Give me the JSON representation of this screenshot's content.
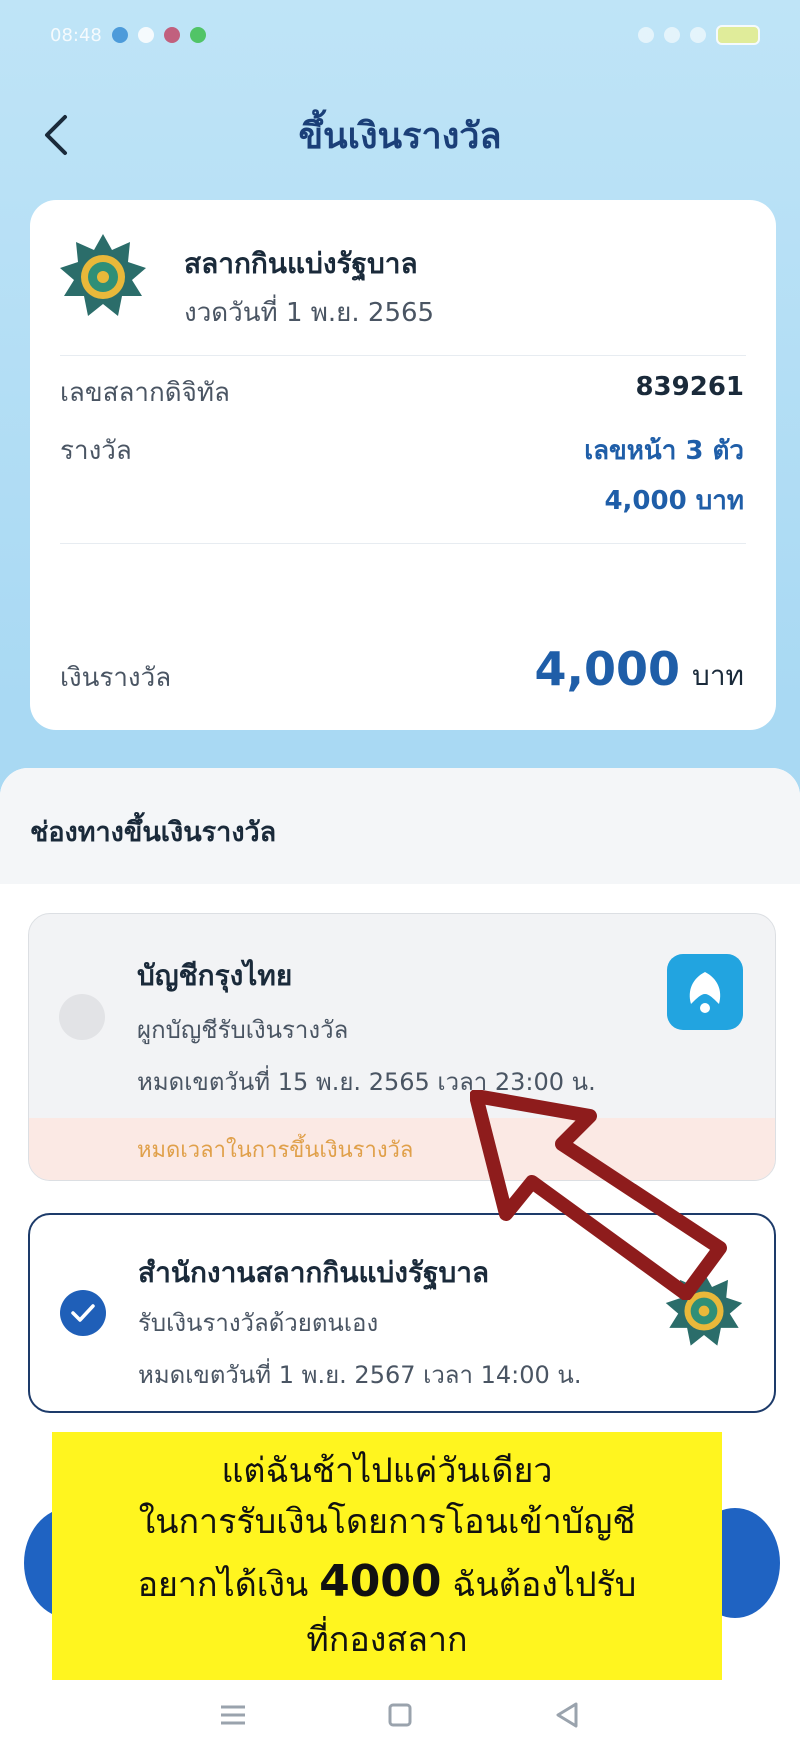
{
  "status_bar": {
    "time": "08:48"
  },
  "header": {
    "title": "ขึ้นเงินรางวัล"
  },
  "ticket": {
    "name": "สลากกินแบ่งรัฐบาล",
    "draw_date": "งวดวันที่ 1 พ.ย. 2565",
    "number_label": "เลขสลากดิจิทัล",
    "number_value": "839261",
    "prize_label": "รางวัล",
    "prize_type": "เลขหน้า 3 ตัว",
    "prize_value": "4,000 บาท",
    "total_label": "เงินรางวัล",
    "total_amount": "4,000",
    "total_unit": "บาท"
  },
  "channels": {
    "section_title": "ช่องทางขึ้นเงินรางวัล",
    "options": [
      {
        "title": "บัญชีกรุงไทย",
        "subtitle": "ผูกบัญชีรับเงินรางวัล",
        "deadline": "หมดเขตวันที่ 15 พ.ย. 2565 เวลา 23:00 น.",
        "warning": "หมดเวลาในการขึ้นเงินรางวัล",
        "selected": false
      },
      {
        "title": "สำนักงานสลากกินแบ่งรัฐบาล",
        "subtitle": "รับเงินรางวัลด้วยตนเอง",
        "deadline": "หมดเขตวันที่ 1 พ.ย. 2567 เวลา 14:00 น.",
        "selected": true
      }
    ]
  },
  "caption": {
    "line1": "แต่ฉันช้าไปแค่วันเดียว",
    "line2": "ในการรับเงินโดยการโอนเข้าบัญชี",
    "line3_pre": "อยากได้เงิน",
    "line3_amount": "4000",
    "line3_post": "ฉันต้องไปรับ",
    "line4": "ที่กองสลาก"
  },
  "icons": {
    "back": "chevron-left-icon",
    "seal": "glo-seal-icon",
    "bank": "ktb-bank-icon",
    "check": "check-icon",
    "arrow": "red-arrow-annotation"
  },
  "colors": {
    "accent_blue": "#1f5ea8",
    "title_navy": "#1b3f78",
    "ktb_blue": "#22a4e0",
    "warning_bg": "#fbe9e4",
    "warning_text": "#e0a04a",
    "caption_bg": "#fff51f",
    "annotation_red": "#8e1c1c"
  }
}
